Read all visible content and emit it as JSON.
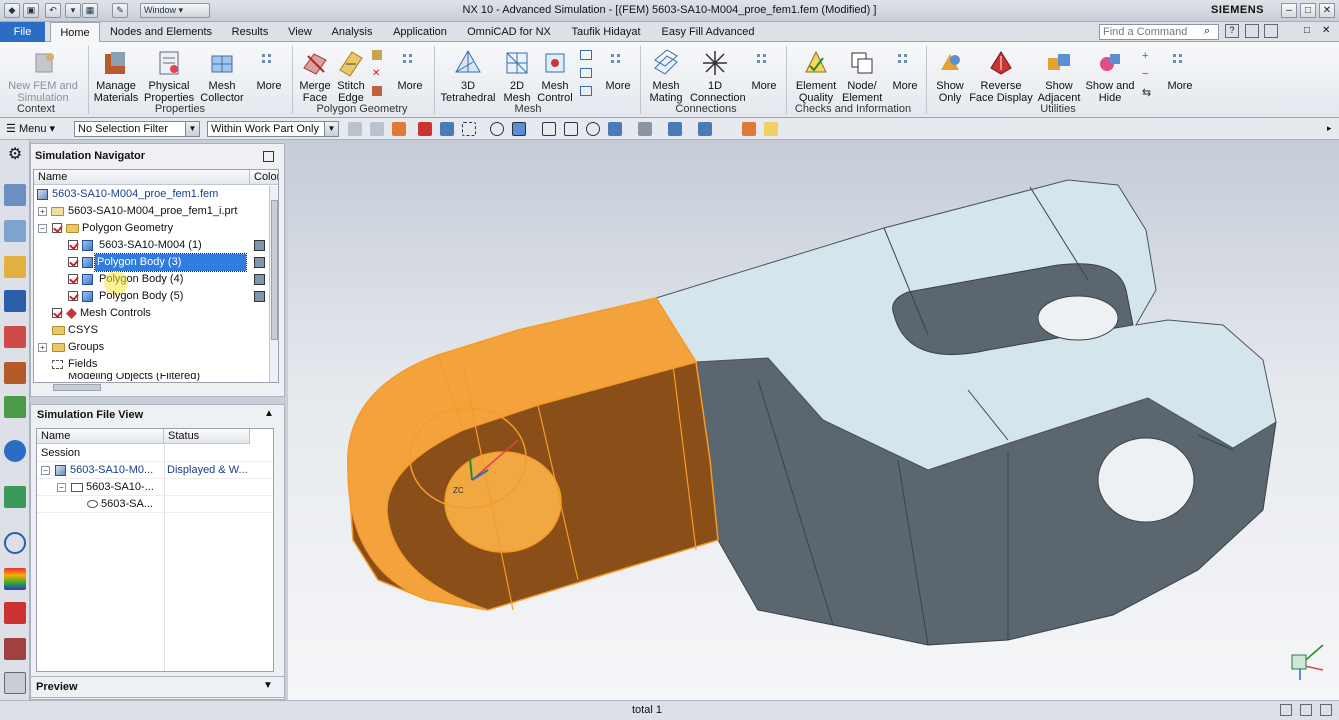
{
  "titlebar": {
    "title": "NX 10 - Advanced Simulation - [(FEM) 5603-SA10-M004_proe_fem1.fem (Modified) ]",
    "window_menu": "Window",
    "brand": "SIEMENS"
  },
  "menubar": {
    "file": "File",
    "tabs": [
      "Home",
      "Nodes and Elements",
      "Results",
      "View",
      "Analysis",
      "Application",
      "OmniCAD for NX",
      "Taufik Hidayat",
      "Easy Fill Advanced"
    ],
    "search_placeholder": "Find a Command"
  },
  "ribbon": {
    "new_fem": "New FEM and Simulation",
    "groups": {
      "context": "Context",
      "properties": "Properties",
      "polygon_geometry": "Polygon Geometry",
      "mesh": "Mesh",
      "connections": "Connections",
      "checks": "Checks and Information",
      "utilities": "Utilities"
    },
    "buttons": {
      "manage_materials": "Manage Materials",
      "physical_properties": "Physical Properties",
      "mesh_collector": "Mesh Collector",
      "merge_face": "Merge Face",
      "stitch_edge": "Stitch Edge",
      "tetrahedral": "3D Tetrahedral",
      "mesh_2d": "2D Mesh",
      "mesh_control": "Mesh Control",
      "mesh_mating": "Mesh Mating",
      "connection_1d": "1D Connection",
      "element_quality": "Element Quality",
      "node_element": "Node/ Element",
      "show_only": "Show Only",
      "reverse_face_display": "Reverse Face Display",
      "show_adjacent": "Show Adjacent",
      "show_and_hide": "Show and Hide",
      "more": "More"
    }
  },
  "toolbar": {
    "menu": "Menu",
    "selection_filter": "No Selection Filter",
    "scope": "Within Work Part Only"
  },
  "navigator": {
    "title": "Simulation Navigator",
    "col_name": "Name",
    "col_color": "Color",
    "rows": [
      "5603-SA10-M004_proe_fem1.fem",
      "5603-SA10-M004_proe_fem1_i.prt",
      "Polygon Geometry",
      "5603-SA10-M004 (1)",
      "Polygon Body (3)",
      "Polygon Body (4)",
      "Polygon Body (5)",
      "Mesh Controls",
      "CSYS",
      "Groups",
      "Fields",
      "Modeling Objects (Filtered)"
    ]
  },
  "fileview": {
    "title": "Simulation File View",
    "col_name": "Name",
    "col_status": "Status",
    "rows": [
      "Session",
      "5603-SA10-M0...",
      "Displayed & W...",
      "5603-SA10-...",
      "5603-SA..."
    ]
  },
  "preview": {
    "title": "Preview"
  },
  "statusbar": {
    "text": "total 1"
  },
  "viewport": {
    "triad_label": "ZC"
  },
  "colors": {
    "accent": "#2b6cc4",
    "selected_body": "#f2a23a",
    "model_top": "#d6e6ec",
    "model_side": "#5a656f"
  }
}
